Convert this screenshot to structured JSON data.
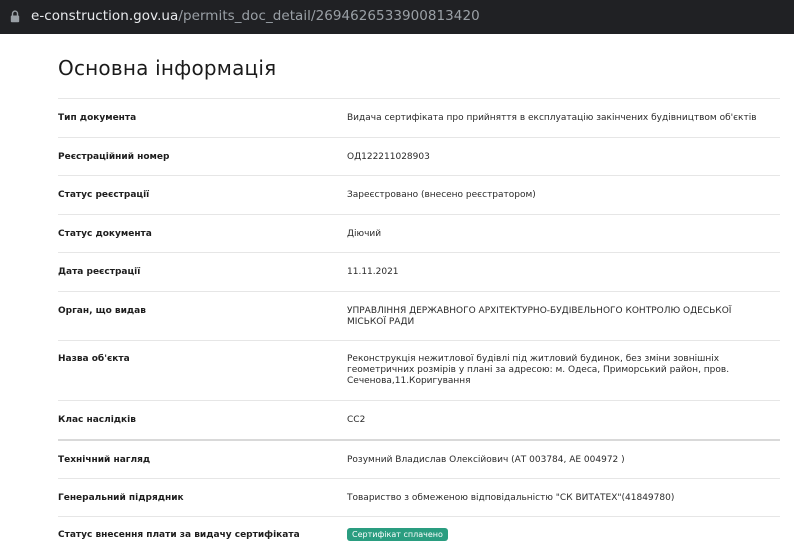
{
  "browser": {
    "url_host": "e-construction.gov.ua",
    "url_path": "/permits_doc_detail/2694626533900813420"
  },
  "page": {
    "title": "Основна інформація"
  },
  "fields": [
    {
      "label": "Тип документа",
      "value": "Видача сертифіката про прийняття в експлуатацію закінчених будівництвом об'єктів"
    },
    {
      "label": "Реєстраційний номер",
      "value": "ОД122211028903"
    },
    {
      "label": "Статус реєстрації",
      "value": "Зареєстровано (внесено реєстратором)"
    },
    {
      "label": "Статус документа",
      "value": "Діючий"
    },
    {
      "label": "Дата реєстрації",
      "value": "11.11.2021"
    },
    {
      "label": "Орган, що видав",
      "value": "УПРАВЛІННЯ ДЕРЖАВНОГО АРХІТЕКТУРНО-БУДІВЕЛЬНОГО КОНТРОЛЮ ОДЕСЬКОЇ МІСЬКОЇ РАДИ"
    },
    {
      "label": "Назва об'єкта",
      "value": "Реконструкція нежитлової будівлі під житловий будинок, без зміни зовнішніх геометричних розмірів у плані за адресою: м. Одеса, Приморський район, пров. Сеченова,11.Коригування"
    },
    {
      "label": "Клас наслідків",
      "value": "СС2"
    },
    {
      "label": "Технічний нагляд",
      "value": "Розумний Владислав Олексійович (АТ 003784, АЕ 004972 )"
    },
    {
      "label": "Генеральний підрядник",
      "value": "Товариство з обмеженою відповідальністю \"СК ВИТАТЕХ\"(41849780)"
    },
    {
      "label": "Статус внесення плати за видачу сертифіката",
      "value": "Сертифікат сплачено"
    }
  ],
  "colors": {
    "badge": "#2a9d80",
    "urlbar": "#202124"
  }
}
